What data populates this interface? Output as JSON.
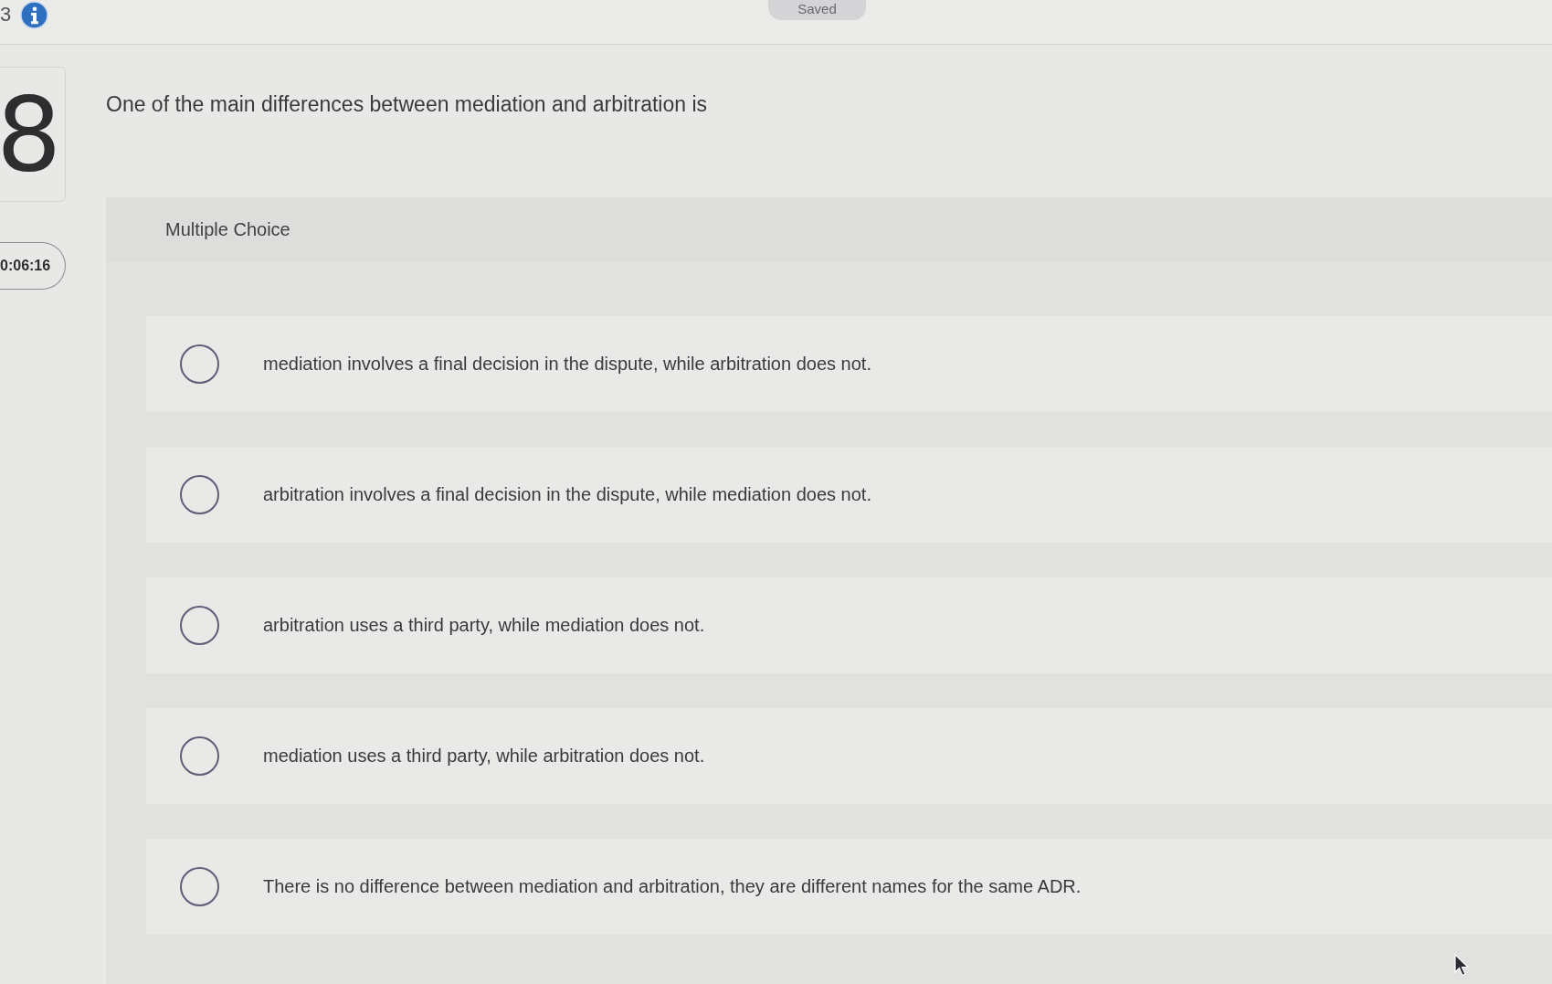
{
  "header": {
    "question_count": "3",
    "status": "Saved"
  },
  "sidebar": {
    "question_number": "8",
    "timer": "0:06:16"
  },
  "question": {
    "prompt": "One of the main differences between mediation and arbitration is",
    "type_label": "Multiple Choice",
    "options": [
      {
        "text": "mediation involves a final decision in the dispute, while arbitration does not.",
        "selected": false
      },
      {
        "text": "arbitration involves a final decision in the dispute, while mediation does not.",
        "selected": false
      },
      {
        "text": "arbitration uses a third party, while mediation does not.",
        "selected": false
      },
      {
        "text": "mediation uses a third party, while arbitration does not.",
        "selected": false
      },
      {
        "text": "There is no difference between mediation and arbitration, they are different names for the same ADR.",
        "selected": false
      }
    ]
  }
}
